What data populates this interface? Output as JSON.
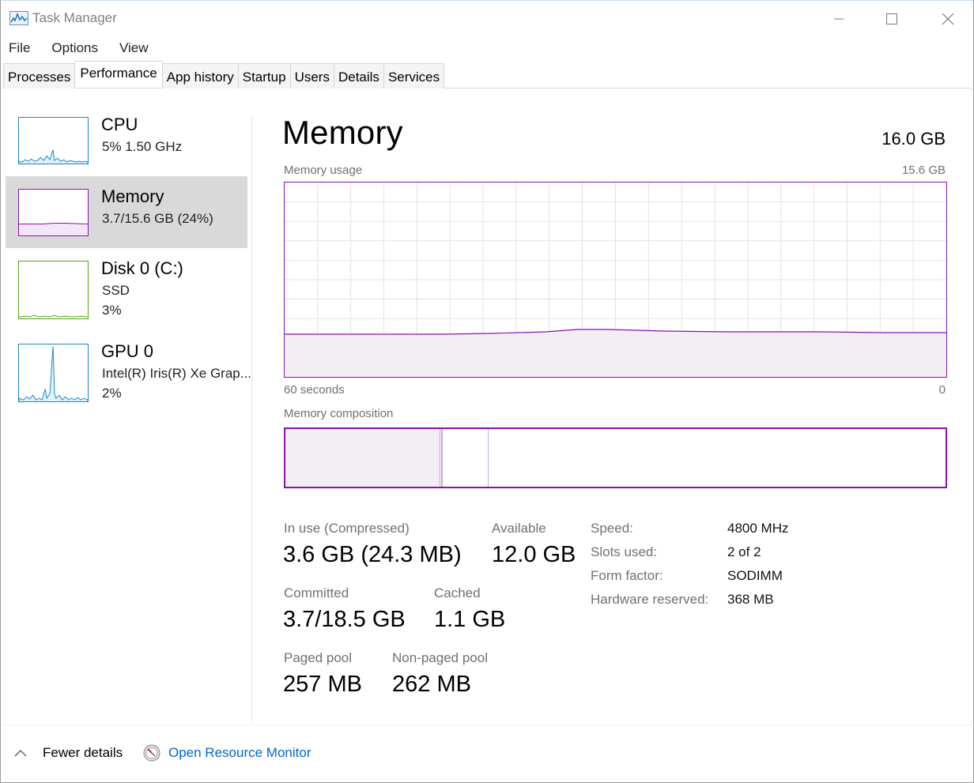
{
  "window": {
    "title": "Task Manager"
  },
  "menu": [
    "File",
    "Options",
    "View"
  ],
  "tabs": [
    "Processes",
    "Performance",
    "App history",
    "Startup",
    "Users",
    "Details",
    "Services"
  ],
  "active_tab": "Performance",
  "sidebar": {
    "items": [
      {
        "title": "CPU",
        "line1": "5%  1.50 GHz",
        "line2": "",
        "color": "#1a88c8"
      },
      {
        "title": "Memory",
        "line1": "3.7/15.6 GB (24%)",
        "line2": "",
        "color": "#8b12ae",
        "selected": true
      },
      {
        "title": "Disk 0 (C:)",
        "line1": "SSD",
        "line2": "3%",
        "color": "#4da60c"
      },
      {
        "title": "GPU 0",
        "line1": "Intel(R) Iris(R) Xe Grap...",
        "line2": "2%",
        "color": "#1a88c8"
      }
    ]
  },
  "main": {
    "title": "Memory",
    "total": "16.0 GB",
    "usage_label": "Memory usage",
    "usage_max": "15.6 GB",
    "time_left": "60 seconds",
    "time_right": "0",
    "composition_label": "Memory composition",
    "accent_color": "#8b12ae",
    "usage_fraction": 0.24
  },
  "stats": {
    "in_use_label": "In use (Compressed)",
    "in_use_value": "3.6 GB (24.3 MB)",
    "available_label": "Available",
    "available_value": "12.0 GB",
    "committed_label": "Committed",
    "committed_value": "3.7/18.5 GB",
    "cached_label": "Cached",
    "cached_value": "1.1 GB",
    "paged_label": "Paged pool",
    "paged_value": "257 MB",
    "nonpaged_label": "Non-paged pool",
    "nonpaged_value": "262 MB"
  },
  "specs": [
    {
      "key": "Speed:",
      "value": "4800 MHz"
    },
    {
      "key": "Slots used:",
      "value": "2 of 2"
    },
    {
      "key": "Form factor:",
      "value": "SODIMM"
    },
    {
      "key": "Hardware reserved:",
      "value": "368 MB"
    }
  ],
  "footer": {
    "fewer_details": "Fewer details",
    "resource_monitor": "Open Resource Monitor"
  }
}
